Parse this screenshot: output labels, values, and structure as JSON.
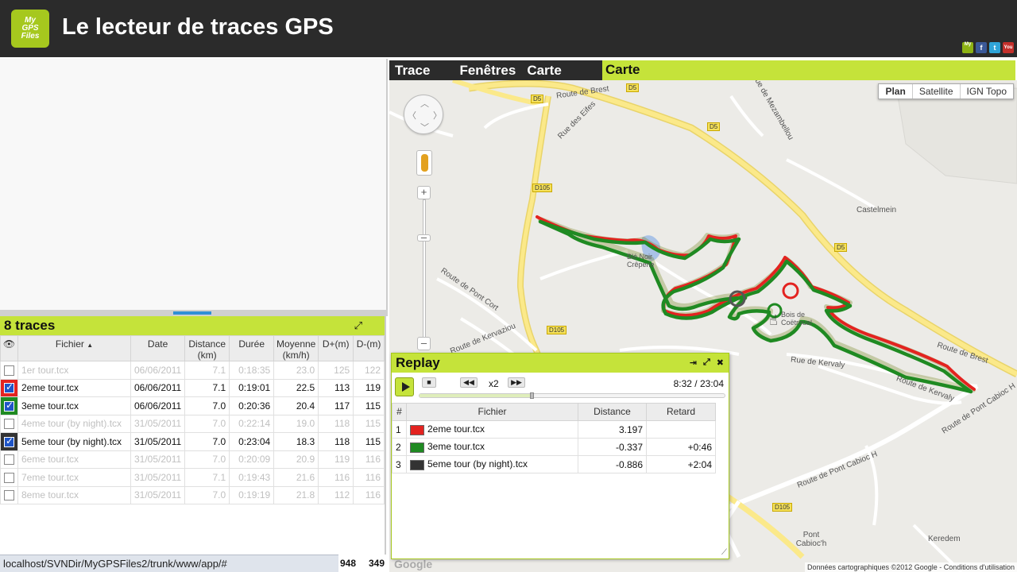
{
  "header": {
    "logo_lines": [
      "My",
      "GPS",
      "Files"
    ],
    "title": "Le lecteur de traces GPS",
    "social": [
      {
        "label": "My",
        "color": "#8db214"
      },
      {
        "label": "f",
        "color": "#3b5998"
      },
      {
        "label": "t",
        "color": "#2fa4d8"
      },
      {
        "label": "You",
        "color": "#c4302b"
      }
    ]
  },
  "traces_panel": {
    "title": "8 traces",
    "columns": [
      "Fichier",
      "Date",
      "Distance (km)",
      "Durée",
      "Moyenne (km/h)",
      "D+(m)",
      "D-(m)"
    ],
    "sort_indicator": "▲",
    "rows": [
      {
        "name": "1er tour.tcx",
        "date": "06/06/2011",
        "distance": "7.1",
        "duration": "0:18:35",
        "avg": "23.0",
        "dplus": "125",
        "dminus": "122",
        "checked": false,
        "color": "none",
        "enabled": false
      },
      {
        "name": "2eme tour.tcx",
        "date": "06/06/2011",
        "distance": "7.1",
        "duration": "0:19:01",
        "avg": "22.5",
        "dplus": "113",
        "dminus": "119",
        "checked": true,
        "color": "red",
        "enabled": true
      },
      {
        "name": "3eme tour.tcx",
        "date": "06/06/2011",
        "distance": "7.0",
        "duration": "0:20:36",
        "avg": "20.4",
        "dplus": "117",
        "dminus": "115",
        "checked": true,
        "color": "green",
        "enabled": true
      },
      {
        "name": "4eme tour (by night).tcx",
        "date": "31/05/2011",
        "distance": "7.0",
        "duration": "0:22:14",
        "avg": "19.0",
        "dplus": "118",
        "dminus": "115",
        "checked": false,
        "color": "none",
        "enabled": false
      },
      {
        "name": "5eme tour (by night).tcx",
        "date": "31/05/2011",
        "distance": "7.0",
        "duration": "0:23:04",
        "avg": "18.3",
        "dplus": "118",
        "dminus": "115",
        "checked": true,
        "color": "dark",
        "enabled": true
      },
      {
        "name": "6eme tour.tcx",
        "date": "31/05/2011",
        "distance": "7.0",
        "duration": "0:20:09",
        "avg": "20.9",
        "dplus": "119",
        "dminus": "116",
        "checked": false,
        "color": "none",
        "enabled": false
      },
      {
        "name": "7eme tour.tcx",
        "date": "31/05/2011",
        "distance": "7.1",
        "duration": "0:19:43",
        "avg": "21.6",
        "dplus": "116",
        "dminus": "116",
        "checked": false,
        "color": "none",
        "enabled": false
      },
      {
        "name": "8eme tour.tcx",
        "date": "31/05/2011",
        "distance": "7.0",
        "duration": "0:19:19",
        "avg": "21.8",
        "dplus": "112",
        "dminus": "116",
        "checked": false,
        "color": "none",
        "enabled": false
      }
    ],
    "totals": {
      "dplus": "948",
      "dminus": "349"
    }
  },
  "statusbar": {
    "url": "localhost/SVNDir/MyGPSFiles2/trunk/www/app/#"
  },
  "menu": {
    "items": [
      "Trace",
      "Fenêtres",
      "Carte"
    ]
  },
  "map": {
    "title": "Carte",
    "types": [
      "Plan",
      "Satellite",
      "IGN Topo"
    ],
    "active_type": "Plan",
    "labels": [
      {
        "text": "Route de Brest"
      },
      {
        "text": "Rue des Eifes"
      },
      {
        "text": "Rue de Mezambellou"
      },
      {
        "text": "Castelmein"
      },
      {
        "text": "Route de Pont Cort"
      },
      {
        "text": "Route de Kervaziou"
      },
      {
        "text": "Rue de Kervaly"
      },
      {
        "text": "Route de Kervaly"
      },
      {
        "text": "Route de Brest"
      },
      {
        "text": "Route de Pont Cabioc H"
      },
      {
        "text": "Route de Pont Cabioc H"
      },
      {
        "text": "Pont Cabioc'h"
      },
      {
        "text": "Keredem"
      },
      {
        "text": "Blé Noir Crêperie"
      },
      {
        "text": "Bois de Coëtroual"
      }
    ],
    "road_tags": [
      "D5",
      "D5",
      "D5",
      "D5",
      "D105",
      "D105",
      "D105"
    ],
    "copyright": "Données cartographiques ©2012 Google - Conditions d'utilisation",
    "google": "Google"
  },
  "replay": {
    "title": "Replay",
    "speed": "x2",
    "time": "8:32 / 23:04",
    "progress": 0.37,
    "columns": [
      "#",
      "Fichier",
      "Distance",
      "Retard"
    ],
    "rows": [
      {
        "num": "1",
        "name": "2eme tour.tcx",
        "distance": "3.197",
        "delay": "",
        "color": "#e32320"
      },
      {
        "num": "2",
        "name": "3eme tour.tcx",
        "distance": "-0.337",
        "delay": "+0:46",
        "color": "#1f8a22"
      },
      {
        "num": "3",
        "name": "5eme tour (by night).tcx",
        "distance": "-0.886",
        "delay": "+2:04",
        "color": "#333333"
      }
    ]
  }
}
